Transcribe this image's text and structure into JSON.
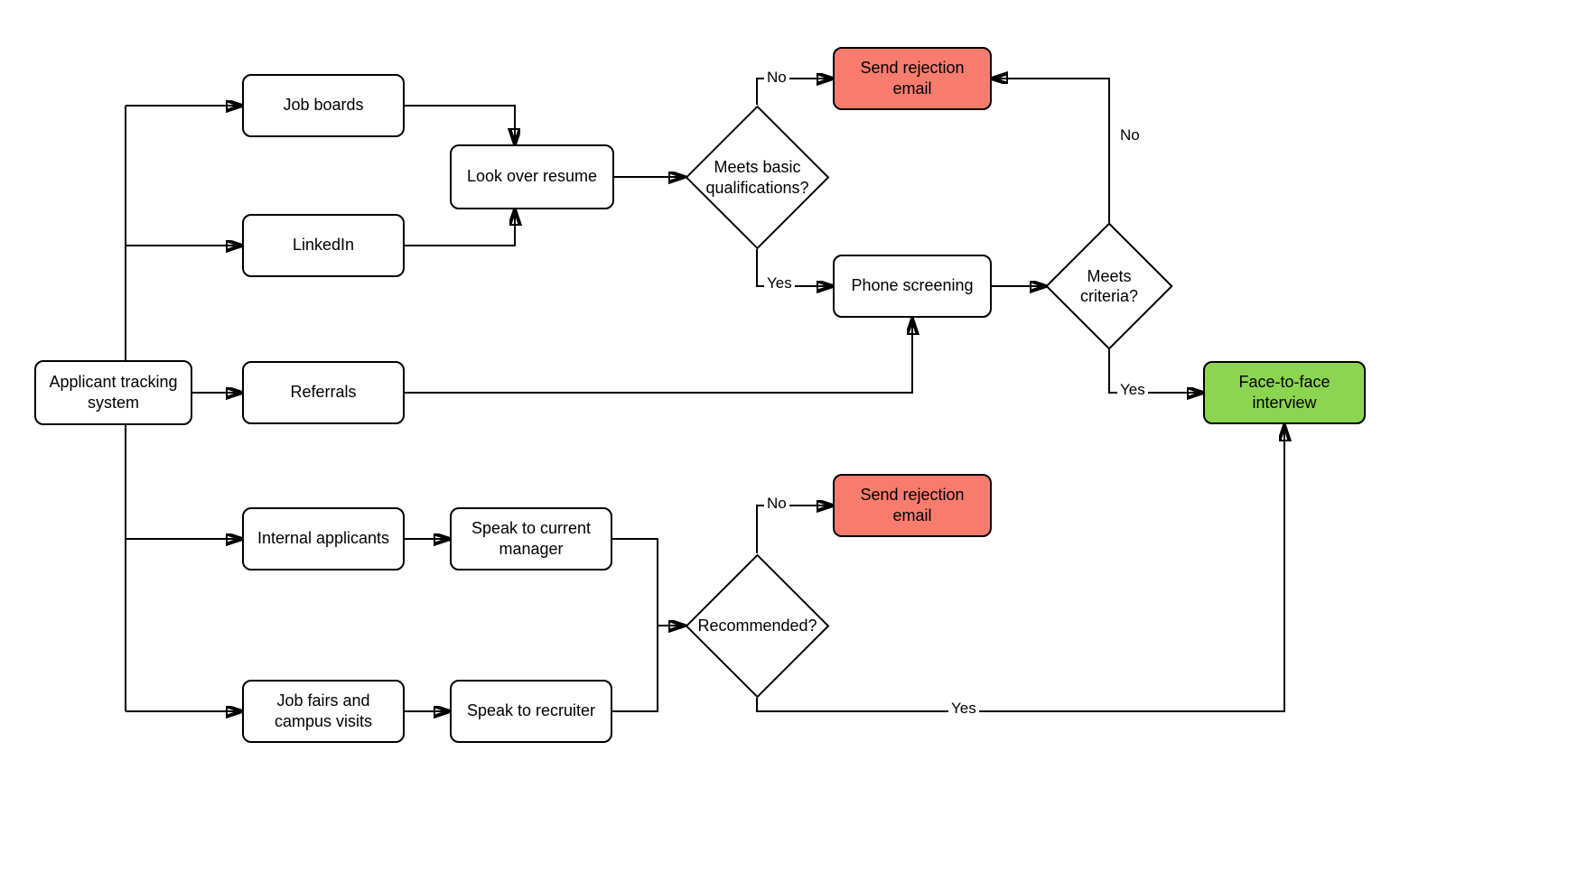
{
  "nodes": {
    "ats": "Applicant tracking system",
    "job_boards": "Job boards",
    "linkedin": "LinkedIn",
    "referrals": "Referrals",
    "internal": "Internal applicants",
    "job_fairs": "Job fairs and campus visits",
    "look_resume": "Look over resume",
    "speak_manager": "Speak to current manager",
    "speak_recruiter": "Speak to recruiter",
    "basic_quals": "Meets basic qualifications?",
    "phone_screen": "Phone screening",
    "meets_criteria": "Meets criteria?",
    "recommended": "Recommended?",
    "reject1": "Send rejection email",
    "reject2": "Send rejection email",
    "face_to_face": "Face-to-face interview"
  },
  "labels": {
    "yes": "Yes",
    "no": "No"
  }
}
